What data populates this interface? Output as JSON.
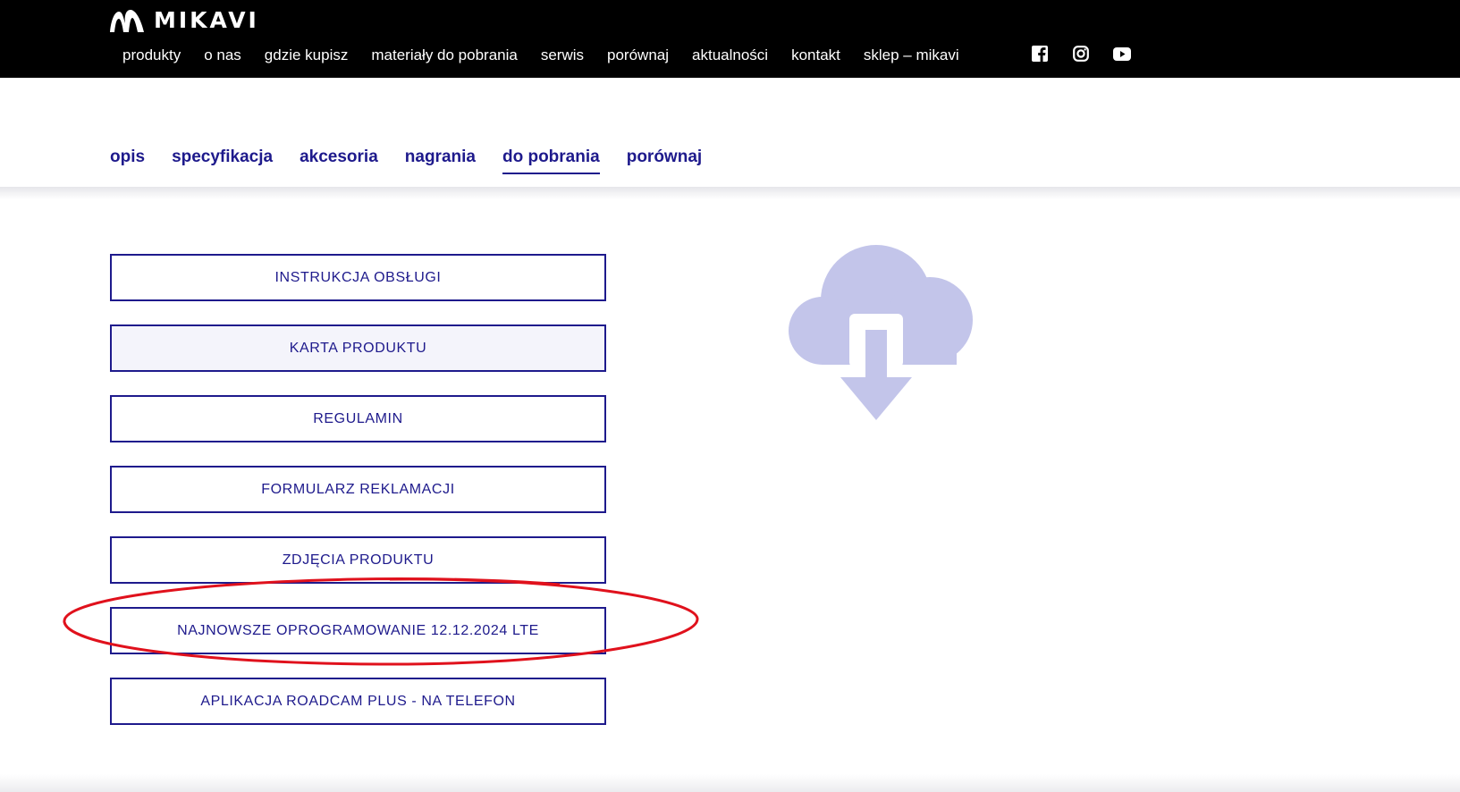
{
  "brand": {
    "logo_text": "MIKAVI"
  },
  "header": {
    "nav": [
      "produkty",
      "o nas",
      "gdzie kupisz",
      "materiały do pobrania",
      "serwis",
      "porównaj",
      "aktualności",
      "kontakt",
      "sklep – mikavi"
    ],
    "social_icons": [
      "facebook-icon",
      "instagram-icon",
      "youtube-icon"
    ]
  },
  "tabs": {
    "items": [
      "opis",
      "specyfikacja",
      "akcesoria",
      "nagrania",
      "do pobrania",
      "porównaj"
    ],
    "active": "do pobrania"
  },
  "downloads": {
    "buttons": [
      "INSTRUKCJA OBSŁUGI",
      "KARTA PRODUKTU",
      "REGULAMIN",
      "FORMULARZ REKLAMACJI",
      "ZDJĘCIA PRODUKTU",
      "NAJNOWSZE OPROGRAMOWANIE 12.12.2024 LTE",
      "APLIKACJA ROADCAM PLUS - NA TELEFON"
    ],
    "illustration_icon": "cloud-download-icon"
  },
  "colors": {
    "header_bg": "#000000",
    "accent": "#1e1a8c",
    "cloud": "#c3c5ea",
    "annotation": "#e0111c"
  }
}
